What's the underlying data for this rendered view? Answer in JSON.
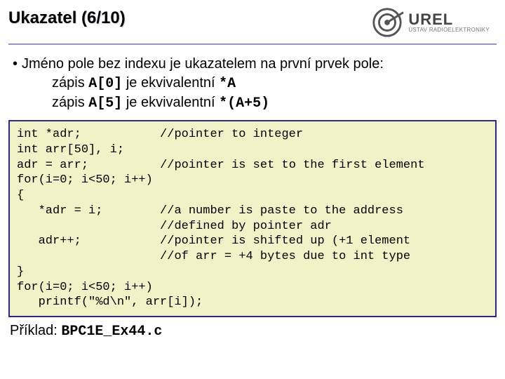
{
  "header": {
    "title": "Ukazatel (6/10)",
    "logo": {
      "name": "UREL",
      "sub": "ÚSTAV RADIOELEKTRONIKY"
    }
  },
  "body": {
    "bullet_lead": "•",
    "line1": "Jméno pole bez indexu je ukazatelem na první prvek pole:",
    "line2a": "zápis ",
    "line2b": "A[0]",
    "line2c": "  je ekvivalentní ",
    "line2d": "*A",
    "line3a": "zápis ",
    "line3b": "A[5]",
    "line3c": " je ekvivalentní ",
    "line3d": "*(A+5)"
  },
  "code": {
    "l1a": "int *adr;",
    "l1b": "//pointer to integer",
    "l2": "int arr[50], i;",
    "l3a": "adr = arr;",
    "l3b": "//pointer is set to the first element",
    "l4": "for(i=0; i<50; i++)",
    "l5": "{",
    "l6a": "   *adr = i;",
    "l6b": "//a number is paste to the address",
    "l7b": "//defined by pointer adr",
    "l8a": "   adr++;",
    "l8b": "//pointer is shifted up (+1 element",
    "l9b": "//of arr = +4 bytes due to int type",
    "l10": "}",
    "l11": "for(i=0; i<50; i++)",
    "l12": "   printf(\"%d\\n\", arr[i]);"
  },
  "footer": {
    "label": "Příklad: ",
    "file": "BPC1E_Ex44.c"
  }
}
